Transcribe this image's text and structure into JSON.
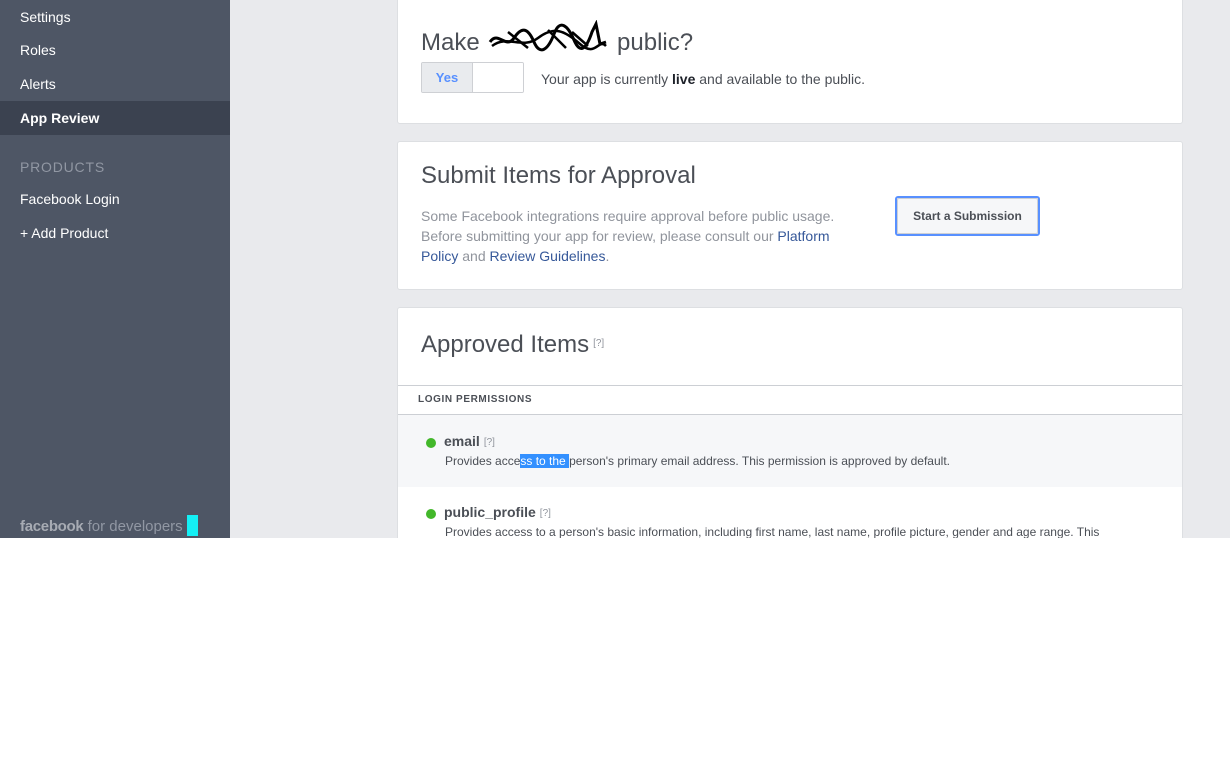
{
  "sidebar": {
    "items": [
      {
        "label": "Settings"
      },
      {
        "label": "Roles"
      },
      {
        "label": "Alerts"
      },
      {
        "label": "App Review"
      }
    ],
    "products_heading": "PRODUCTS",
    "product_items": [
      {
        "label": "Facebook Login"
      },
      {
        "label": "+ Add Product"
      }
    ],
    "brand": {
      "facebook": "facebook",
      "suffix": "for developers"
    }
  },
  "public_card": {
    "title_prefix": "Make",
    "title_suffix": "public?",
    "toggle_label": "Yes",
    "status_before": "Your app is currently",
    "status_bold": "live",
    "status_after": "and available to the public."
  },
  "submit_card": {
    "title": "Submit Items for Approval",
    "desc_1": "Some Facebook integrations require approval before public usage. Before submitting your app for review, please consult our",
    "link_policy": "Platform Policy",
    "desc_and": "and",
    "link_guidelines": "Review Guidelines",
    "desc_end": ".",
    "button_label": "Start a Submission"
  },
  "approved_card": {
    "title": "Approved Items",
    "help": "[?]",
    "section_label": "LOGIN PERMISSIONS",
    "permissions": [
      {
        "name": "email",
        "help": "[?]",
        "desc_before": "Provides acce",
        "desc_highlight": "ss to the ",
        "desc_after": "person's primary email address. This permission is approved by default."
      },
      {
        "name": "public_profile",
        "help": "[?]",
        "desc": "Provides access to a person's basic information, including first name, last name, profile picture, gender and age range. This"
      }
    ]
  },
  "colors": {
    "sidebar_bg": "#4e5665",
    "sidebar_active": "#3b4250",
    "accent": "#5890ff",
    "link": "#365899",
    "status_green": "#42b72a",
    "selection": "#3390ff"
  }
}
